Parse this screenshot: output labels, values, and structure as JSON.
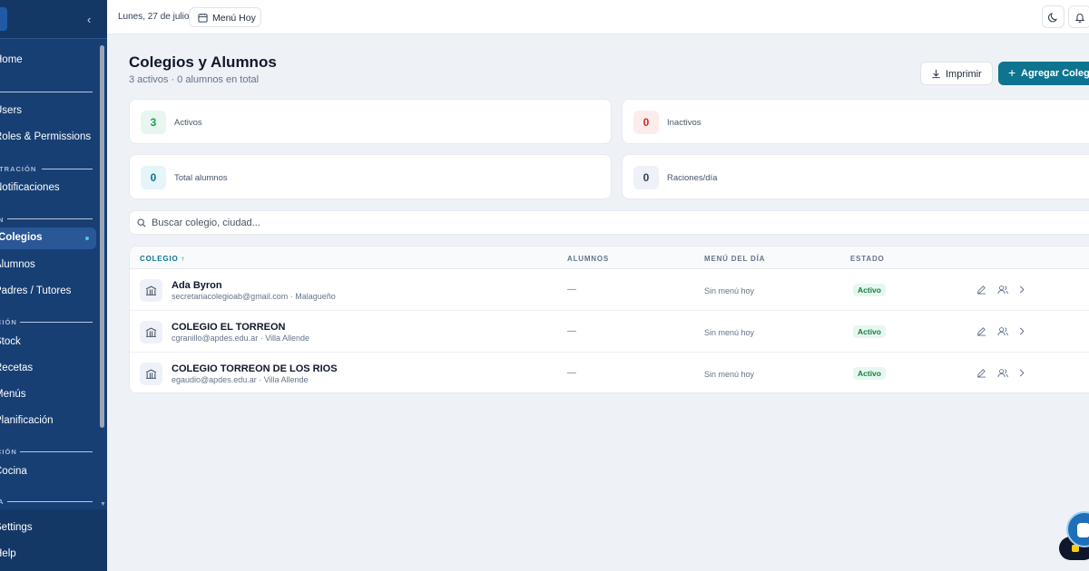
{
  "sidebar": {
    "items": [
      {
        "label": "Home"
      },
      {
        "label": "Users"
      },
      {
        "label": "Roles & Permissions"
      },
      {
        "label": "Notificaciones"
      },
      {
        "label": "Colegios"
      },
      {
        "label": "Alumnos"
      },
      {
        "label": "Padres / Tutores"
      },
      {
        "label": "Stock"
      },
      {
        "label": "Recetas"
      },
      {
        "label": "Menús"
      },
      {
        "label": "Planificación"
      },
      {
        "label": "Cocina"
      },
      {
        "label": "Settings"
      },
      {
        "label": "Help"
      }
    ],
    "sections": [
      "ISTRACIÓN",
      "N",
      "CIÓN",
      "CIÓN",
      "A"
    ]
  },
  "topbar": {
    "date": "Lunes, 27 de julio",
    "menu_hoy": "Menú Hoy"
  },
  "header": {
    "title": "Colegios y Alumnos",
    "subtitle": "3 activos · 0 alumnos en total",
    "print_label": "Imprimir",
    "add_label": "Agregar Colegio"
  },
  "stats": [
    {
      "value": "3",
      "label": "Activos",
      "color": "#16a34a"
    },
    {
      "value": "0",
      "label": "Inactivos",
      "color": "#dc2626"
    },
    {
      "value": "0",
      "label": "Total alumnos",
      "color": "#0e7490"
    },
    {
      "value": "0",
      "label": "Raciones/día",
      "color": "#334155"
    }
  ],
  "search": {
    "placeholder": "Buscar colegio, ciudad..."
  },
  "table": {
    "columns": [
      "COLEGIO",
      "ALUMNOS",
      "MENÚ DEL DÍA",
      "ESTADO"
    ],
    "sort_indicator": "↑",
    "rows": [
      {
        "name": "Ada Byron",
        "sub": "secretariacolegioab@gmail.com · Malagueño",
        "alumnos": "—",
        "menu": "Sin menú hoy",
        "estado": "Activo"
      },
      {
        "name": "COLEGIO EL TORREON",
        "sub": "cgranillo@apdes.edu.ar · Villa Allende",
        "alumnos": "—",
        "menu": "Sin menú hoy",
        "estado": "Activo"
      },
      {
        "name": "COLEGIO TORREON DE LOS RIOS",
        "sub": "egaudio@apdes.edu.ar · Villa Allende",
        "alumnos": "—",
        "menu": "Sin menú hoy",
        "estado": "Activo"
      }
    ]
  },
  "colors": {
    "sidebar_bg": "#173f74",
    "accent": "#0e7490",
    "active_badge": "#15803d"
  }
}
